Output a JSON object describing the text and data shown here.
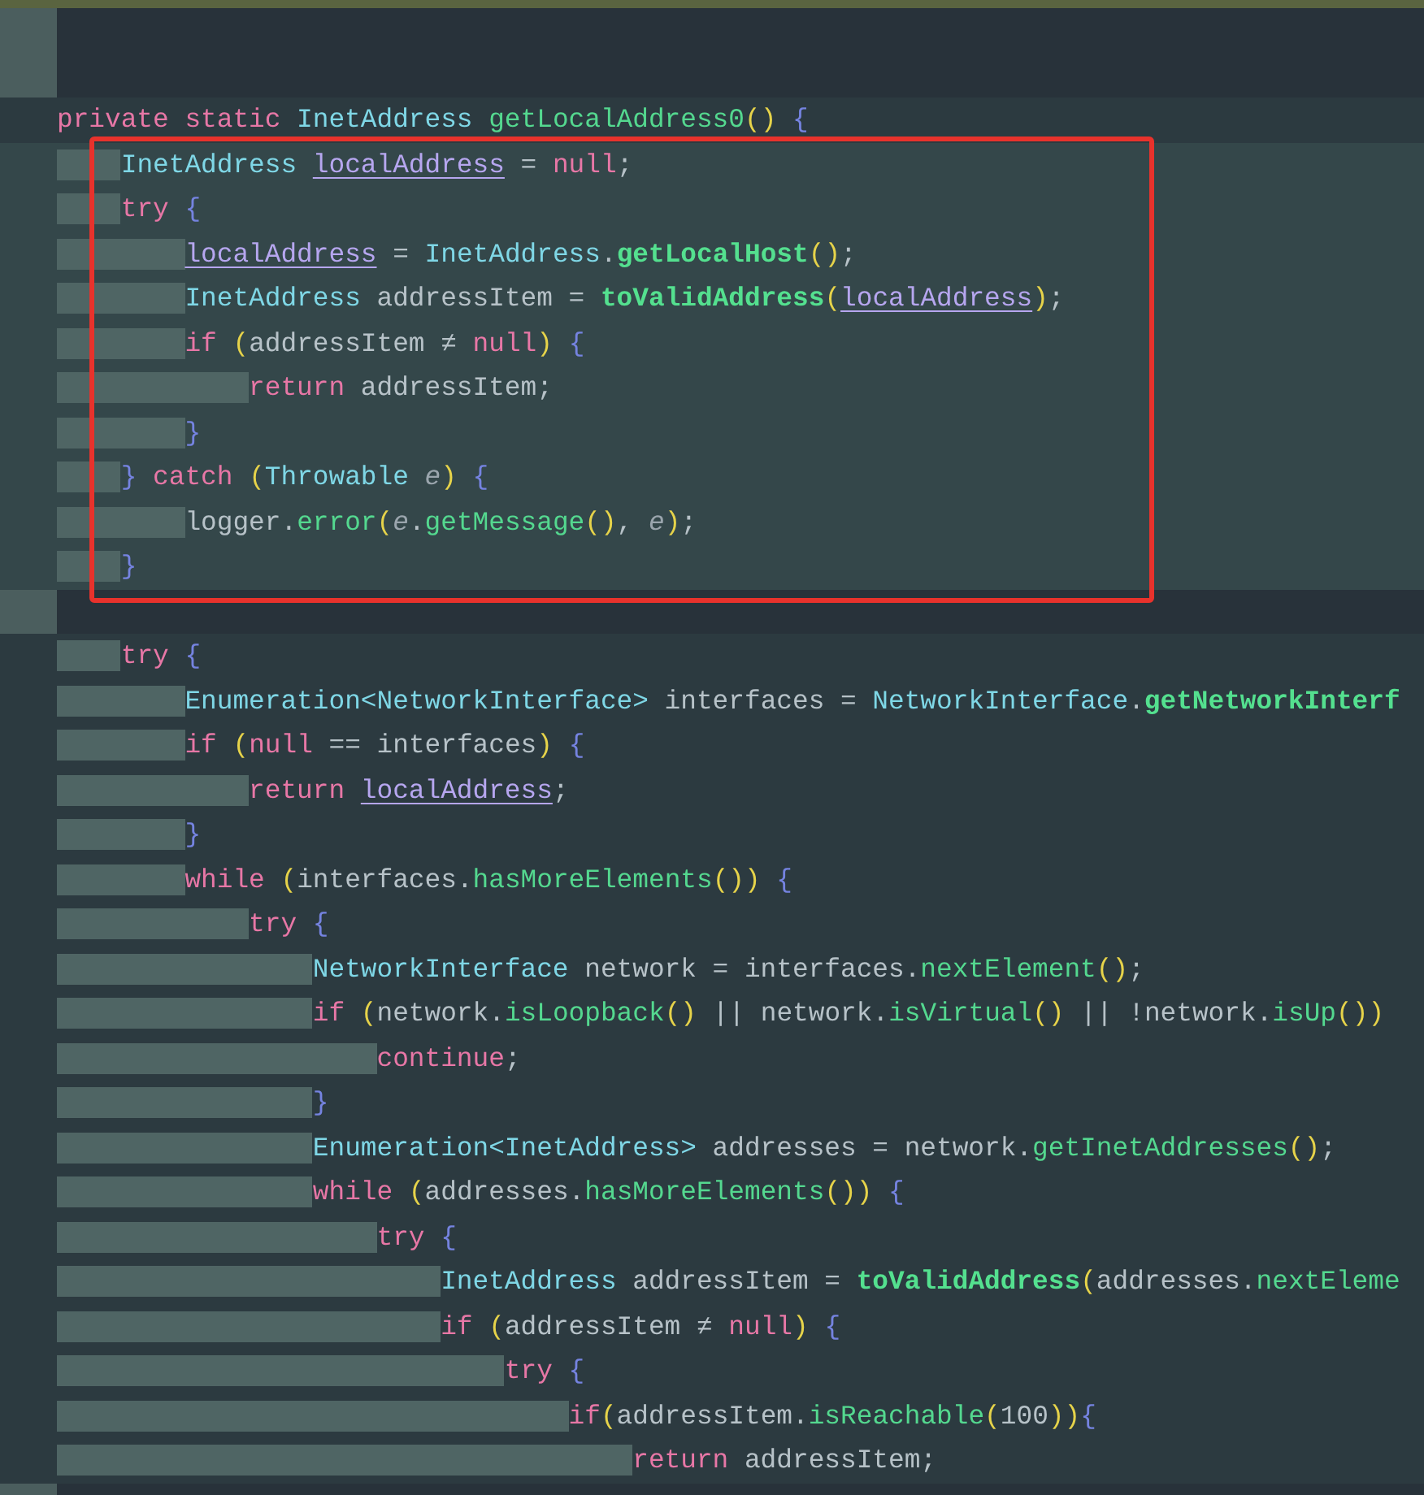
{
  "editor": {
    "sections": [
      {
        "boxed": false,
        "lines": [
          {
            "kind": "code",
            "tokens": [
              {
                "kind": "kw",
                "text": "private static "
              },
              {
                "kind": "type",
                "text": "InetAddress "
              },
              {
                "kind": "fn",
                "text": "getLocalAddress0"
              },
              {
                "kind": "paren",
                "text": "()"
              },
              {
                "kind": "brace",
                "text": " {"
              }
            ]
          }
        ]
      },
      {
        "boxed": true,
        "lines": [
          {
            "kind": "code",
            "tokens": [
              {
                "kind": "type",
                "text": "    InetAddress "
              },
              {
                "kind": "field",
                "text": "localAddress"
              },
              {
                "kind": "plain",
                "text": " = "
              },
              {
                "kind": "kw",
                "text": "null"
              },
              {
                "kind": "plain",
                "text": ";"
              }
            ]
          },
          {
            "kind": "code",
            "tokens": [
              {
                "kind": "kw",
                "text": "    try "
              },
              {
                "kind": "brace",
                "text": "{"
              }
            ]
          },
          {
            "kind": "code",
            "tokens": [
              {
                "kind": "field",
                "text": "        localAddress"
              },
              {
                "kind": "plain",
                "text": " = "
              },
              {
                "kind": "type",
                "text": "InetAddress"
              },
              {
                "kind": "plain",
                "text": "."
              },
              {
                "kind": "fnb",
                "text": "getLocalHost"
              },
              {
                "kind": "paren",
                "text": "()"
              },
              {
                "kind": "plain",
                "text": ";"
              }
            ]
          },
          {
            "kind": "code",
            "tokens": [
              {
                "kind": "type",
                "text": "        InetAddress "
              },
              {
                "kind": "plain",
                "text": "addressItem = "
              },
              {
                "kind": "fnb",
                "text": "toValidAddress"
              },
              {
                "kind": "paren",
                "text": "("
              },
              {
                "kind": "field",
                "text": "localAddress"
              },
              {
                "kind": "paren",
                "text": ")"
              },
              {
                "kind": "plain",
                "text": ";"
              }
            ]
          },
          {
            "kind": "code",
            "tokens": [
              {
                "kind": "kw",
                "text": "        if "
              },
              {
                "kind": "paren",
                "text": "("
              },
              {
                "kind": "plain",
                "text": "addressItem ≠ "
              },
              {
                "kind": "kw",
                "text": "null"
              },
              {
                "kind": "paren",
                "text": ")"
              },
              {
                "kind": "brace",
                "text": " {"
              }
            ]
          },
          {
            "kind": "code",
            "tokens": [
              {
                "kind": "kw",
                "text": "            return "
              },
              {
                "kind": "plain",
                "text": "addressItem;"
              }
            ]
          },
          {
            "kind": "code",
            "tokens": [
              {
                "kind": "brace",
                "text": "        }"
              }
            ]
          },
          {
            "kind": "code",
            "tokens": [
              {
                "kind": "brace",
                "text": "    }"
              },
              {
                "kind": "kw",
                "text": " catch "
              },
              {
                "kind": "paren",
                "text": "("
              },
              {
                "kind": "type",
                "text": "Throwable "
              },
              {
                "kind": "param",
                "text": "e"
              },
              {
                "kind": "paren",
                "text": ")"
              },
              {
                "kind": "brace",
                "text": " {"
              }
            ]
          },
          {
            "kind": "code",
            "tokens": [
              {
                "kind": "plain",
                "text": "        logger."
              },
              {
                "kind": "fn",
                "text": "error"
              },
              {
                "kind": "paren",
                "text": "("
              },
              {
                "kind": "param",
                "text": "e"
              },
              {
                "kind": "plain",
                "text": "."
              },
              {
                "kind": "fn",
                "text": "getMessage"
              },
              {
                "kind": "paren",
                "text": "()"
              },
              {
                "kind": "plain",
                "text": ", "
              },
              {
                "kind": "param",
                "text": "e"
              },
              {
                "kind": "paren",
                "text": ")"
              },
              {
                "kind": "plain",
                "text": ";"
              }
            ]
          },
          {
            "kind": "code",
            "tokens": [
              {
                "kind": "brace",
                "text": "    }"
              }
            ]
          }
        ]
      },
      {
        "boxed": false,
        "lines": [
          {
            "kind": "blank"
          },
          {
            "kind": "code",
            "tokens": [
              {
                "kind": "kw",
                "text": "    try "
              },
              {
                "kind": "brace",
                "text": "{"
              }
            ]
          },
          {
            "kind": "code",
            "tokens": [
              {
                "kind": "type",
                "text": "        Enumeration<NetworkInterface> "
              },
              {
                "kind": "plain",
                "text": "interfaces = "
              },
              {
                "kind": "type",
                "text": "NetworkInterface"
              },
              {
                "kind": "plain",
                "text": "."
              },
              {
                "kind": "fnb",
                "text": "getNetworkInterf"
              }
            ]
          },
          {
            "kind": "code",
            "tokens": [
              {
                "kind": "kw",
                "text": "        if "
              },
              {
                "kind": "paren",
                "text": "("
              },
              {
                "kind": "kw",
                "text": "null"
              },
              {
                "kind": "plain",
                "text": " == interfaces"
              },
              {
                "kind": "paren",
                "text": ")"
              },
              {
                "kind": "brace",
                "text": " {"
              }
            ]
          },
          {
            "kind": "code",
            "tokens": [
              {
                "kind": "kw",
                "text": "            return "
              },
              {
                "kind": "field",
                "text": "localAddress"
              },
              {
                "kind": "plain",
                "text": ";"
              }
            ]
          },
          {
            "kind": "code",
            "tokens": [
              {
                "kind": "brace",
                "text": "        }"
              }
            ]
          },
          {
            "kind": "code",
            "tokens": [
              {
                "kind": "kw",
                "text": "        while "
              },
              {
                "kind": "paren",
                "text": "("
              },
              {
                "kind": "plain",
                "text": "interfaces."
              },
              {
                "kind": "fn",
                "text": "hasMoreElements"
              },
              {
                "kind": "paren",
                "text": "())"
              },
              {
                "kind": "brace",
                "text": " {"
              }
            ]
          },
          {
            "kind": "code",
            "tokens": [
              {
                "kind": "kw",
                "text": "            try "
              },
              {
                "kind": "brace",
                "text": "{"
              }
            ]
          },
          {
            "kind": "code",
            "tokens": [
              {
                "kind": "type",
                "text": "                NetworkInterface "
              },
              {
                "kind": "plain",
                "text": "network = interfaces."
              },
              {
                "kind": "fn",
                "text": "nextElement"
              },
              {
                "kind": "paren",
                "text": "()"
              },
              {
                "kind": "plain",
                "text": ";"
              }
            ]
          },
          {
            "kind": "code",
            "tokens": [
              {
                "kind": "kw",
                "text": "                if "
              },
              {
                "kind": "paren",
                "text": "("
              },
              {
                "kind": "plain",
                "text": "network."
              },
              {
                "kind": "fn",
                "text": "isLoopback"
              },
              {
                "kind": "paren",
                "text": "()"
              },
              {
                "kind": "plain",
                "text": " || network."
              },
              {
                "kind": "fn",
                "text": "isVirtual"
              },
              {
                "kind": "paren",
                "text": "()"
              },
              {
                "kind": "plain",
                "text": " || !network."
              },
              {
                "kind": "fn",
                "text": "isUp"
              },
              {
                "kind": "paren",
                "text": "())"
              }
            ]
          },
          {
            "kind": "code",
            "tokens": [
              {
                "kind": "kw",
                "text": "                    continue"
              },
              {
                "kind": "plain",
                "text": ";"
              }
            ]
          },
          {
            "kind": "code",
            "tokens": [
              {
                "kind": "brace",
                "text": "                }"
              }
            ]
          },
          {
            "kind": "code",
            "tokens": [
              {
                "kind": "type",
                "text": "                Enumeration<InetAddress> "
              },
              {
                "kind": "plain",
                "text": "addresses = network."
              },
              {
                "kind": "fn",
                "text": "getInetAddresses"
              },
              {
                "kind": "paren",
                "text": "()"
              },
              {
                "kind": "plain",
                "text": ";"
              }
            ]
          },
          {
            "kind": "code",
            "tokens": [
              {
                "kind": "kw",
                "text": "                while "
              },
              {
                "kind": "paren",
                "text": "("
              },
              {
                "kind": "plain",
                "text": "addresses."
              },
              {
                "kind": "fn",
                "text": "hasMoreElements"
              },
              {
                "kind": "paren",
                "text": "())"
              },
              {
                "kind": "brace",
                "text": " {"
              }
            ]
          },
          {
            "kind": "code",
            "tokens": [
              {
                "kind": "kw",
                "text": "                    try "
              },
              {
                "kind": "brace",
                "text": "{"
              }
            ]
          },
          {
            "kind": "code",
            "tokens": [
              {
                "kind": "type",
                "text": "                        InetAddress "
              },
              {
                "kind": "plain",
                "text": "addressItem = "
              },
              {
                "kind": "fnb",
                "text": "toValidAddress"
              },
              {
                "kind": "paren",
                "text": "("
              },
              {
                "kind": "plain",
                "text": "addresses."
              },
              {
                "kind": "fn",
                "text": "nextEleme"
              }
            ]
          },
          {
            "kind": "code",
            "tokens": [
              {
                "kind": "kw",
                "text": "                        if "
              },
              {
                "kind": "paren",
                "text": "("
              },
              {
                "kind": "plain",
                "text": "addressItem ≠ "
              },
              {
                "kind": "kw",
                "text": "null"
              },
              {
                "kind": "paren",
                "text": ")"
              },
              {
                "kind": "brace",
                "text": " {"
              }
            ]
          },
          {
            "kind": "code",
            "tokens": [
              {
                "kind": "kw",
                "text": "                            try "
              },
              {
                "kind": "brace",
                "text": "{"
              }
            ]
          },
          {
            "kind": "code",
            "tokens": [
              {
                "kind": "kw",
                "text": "                                if"
              },
              {
                "kind": "paren",
                "text": "("
              },
              {
                "kind": "plain",
                "text": "addressItem."
              },
              {
                "kind": "fn",
                "text": "isReachable"
              },
              {
                "kind": "paren",
                "text": "("
              },
              {
                "kind": "plain",
                "text": "100"
              },
              {
                "kind": "paren",
                "text": "))"
              },
              {
                "kind": "brace",
                "text": "{"
              }
            ]
          },
          {
            "kind": "code",
            "tokens": [
              {
                "kind": "kw",
                "text": "                                    return "
              },
              {
                "kind": "plain",
                "text": "addressItem;"
              }
            ]
          }
        ]
      }
    ]
  }
}
